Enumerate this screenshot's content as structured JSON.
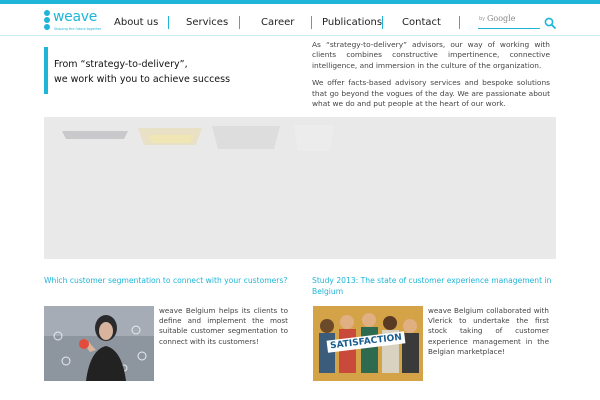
{
  "brand": {
    "name": "weave",
    "tagline": "Shaping the future together",
    "accent_color": "#1fb5d8"
  },
  "nav": {
    "items": [
      {
        "label": "About us"
      },
      {
        "label": "Services"
      },
      {
        "label": "Career"
      },
      {
        "label": "Publications"
      },
      {
        "label": "Contact"
      }
    ]
  },
  "search": {
    "by_label": "by",
    "provider_label": "Google",
    "icon": "search-icon"
  },
  "hero": {
    "line1": "From “strategy-to-delivery”,",
    "line2": "we work with you to achieve success"
  },
  "intro": {
    "paragraph1": "As “strategy-to-delivery” advisors, our way of working with clients combines constructive impertinence, connective intelligence, and immersion in the culture of the organization.",
    "paragraph2": "We offer facts-based advisory services and bespoke solutions that go beyond the vogues of the day. We are passionate about what we do and put people at the heart of our work."
  },
  "articles": [
    {
      "title": "Which customer segmentation to connect with your customers?",
      "text": "weave Belgium helps its clients to define and implement the most suitable customer segmentation to connect with its customers!"
    },
    {
      "title": "Study 2013: The state of customer experience management in Belgium",
      "text": "weave Belgium collaborated with Vlerick to undertake the first stock taking of customer experience management in the Belgian marketplace!",
      "image_caption": "SATISFACTION"
    }
  ]
}
